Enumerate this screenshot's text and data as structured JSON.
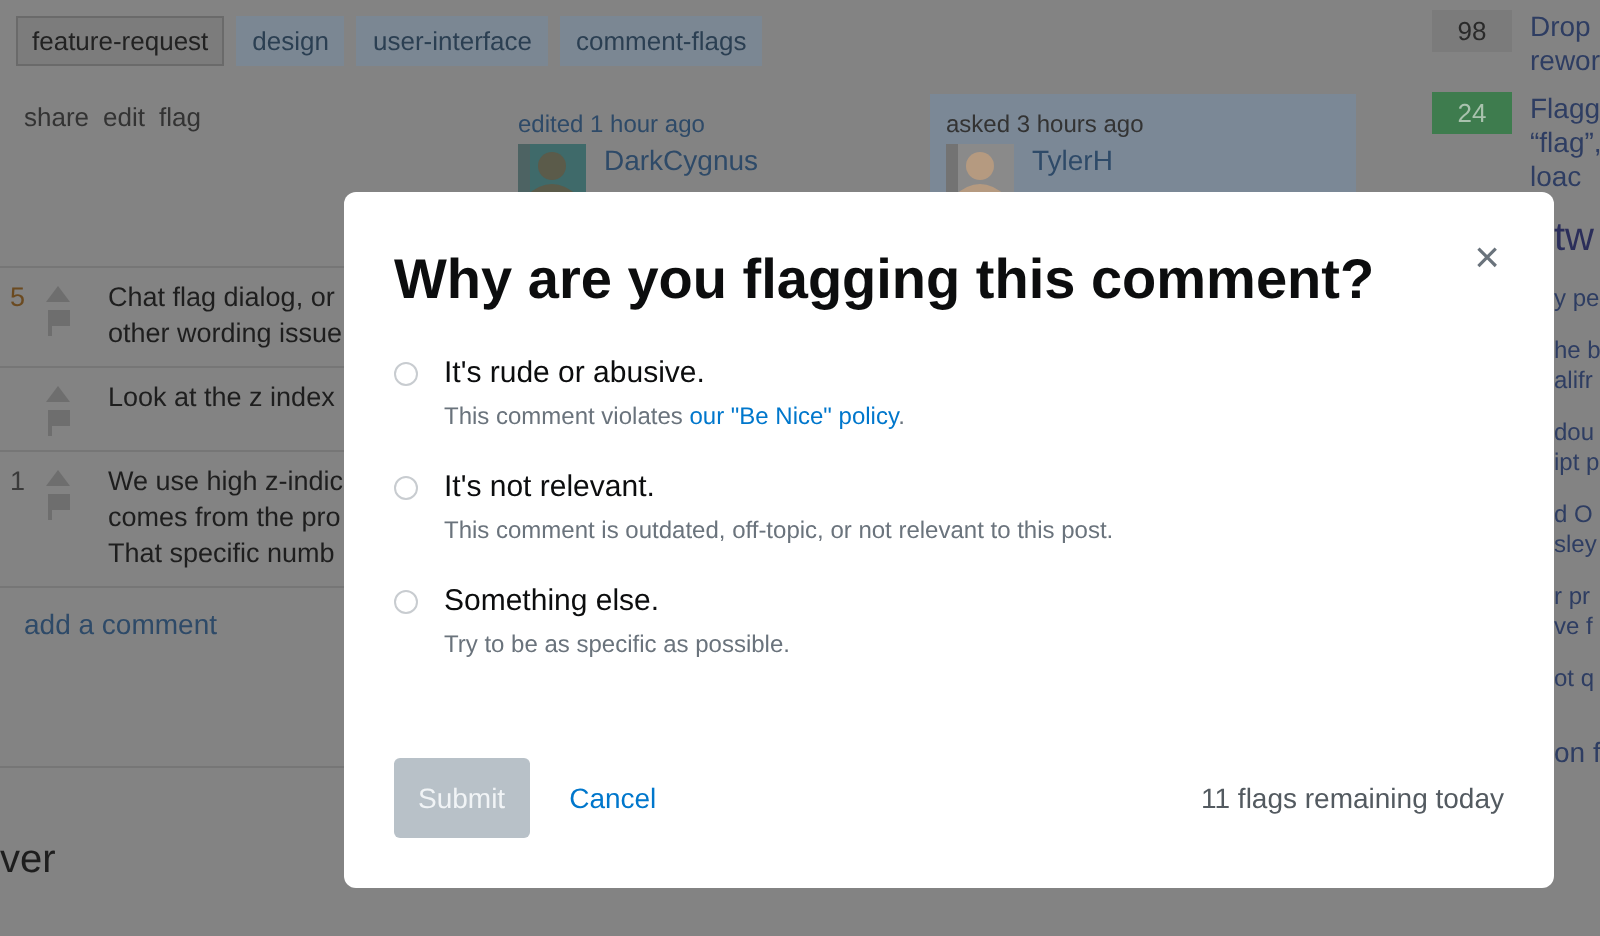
{
  "tags": [
    {
      "label": "feature-request",
      "selected": true
    },
    {
      "label": "design",
      "selected": false
    },
    {
      "label": "user-interface",
      "selected": false
    },
    {
      "label": "comment-flags",
      "selected": false
    }
  ],
  "post_menu": [
    "share",
    "edit",
    "flag"
  ],
  "editor": {
    "action": "edited 1 hour ago",
    "name": "DarkCygnus"
  },
  "asker": {
    "action": "asked 3 hours ago",
    "name": "TylerH"
  },
  "comments": [
    {
      "score": "5",
      "hot": true,
      "lines": [
        "Chat flag dialog, or",
        "other wording issue"
      ]
    },
    {
      "lines": [
        "Look at the z index"
      ]
    },
    {
      "score": "1",
      "hot": false,
      "lines": [
        "We use high z-indic",
        "comes from the pro",
        "That specific numb"
      ]
    }
  ],
  "add_comment": "add a comment",
  "answers_heading": "ver",
  "sidebar": {
    "linked": [
      {
        "score": "98",
        "accepted": false,
        "lines": [
          "Drop",
          "rewor"
        ]
      },
      {
        "score": "24",
        "accepted": true,
        "lines": [
          "Flagg",
          "“flag”,",
          "loac"
        ]
      }
    ],
    "network_heading": "tw",
    "network_items": [
      {
        "lines": [
          "y pe"
        ]
      },
      {
        "lines": [
          "he b",
          "alifr"
        ]
      },
      {
        "lines": [
          "dou",
          "ipt p"
        ]
      },
      {
        "lines": [
          "d O",
          "sley"
        ]
      },
      {
        "lines": [
          "r pr",
          "ve f"
        ]
      },
      {
        "lines": [
          "ot q"
        ]
      },
      {
        "lines": [
          "on f"
        ]
      }
    ]
  },
  "dialog": {
    "title": "Why are you flagging this comment?",
    "close": "×",
    "options": [
      {
        "label": "It's rude or abusive.",
        "description": "This comment violates ",
        "link": "our \"Be Nice\" policy",
        "suffix": ".",
        "selected": false
      },
      {
        "label": "It's not relevant.",
        "description": "This comment is outdated, off-topic, or not relevant to this post.",
        "selected": false
      },
      {
        "label": "Something else.",
        "description": "Try to be as specific as possible.",
        "selected": false
      }
    ],
    "submit": {
      "label": "Submit",
      "disabled": true
    },
    "cancel": "Cancel",
    "remaining": "11 flags remaining today"
  }
}
